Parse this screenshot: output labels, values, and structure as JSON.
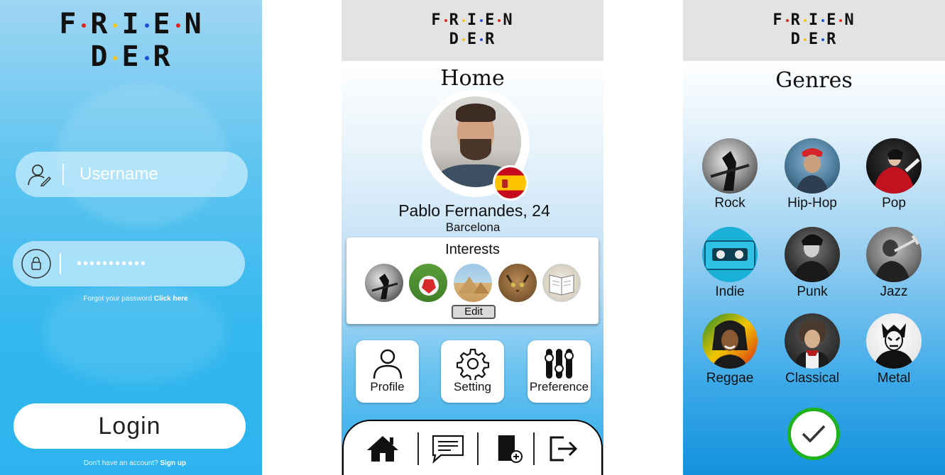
{
  "app": {
    "logo_line1": [
      "F",
      "R",
      "I",
      "E",
      "N"
    ],
    "logo_line2": [
      "D",
      "E",
      "R"
    ]
  },
  "login": {
    "username_placeholder": "Username",
    "password_value": "•••••••••••",
    "forgot_text": "Forgot your password",
    "forgot_link": "Click here",
    "login_label": "Login",
    "signup_text": "Don't have an account?",
    "signup_link": "Sign up"
  },
  "home": {
    "title": "Home",
    "user_name": "Pablo Fernandes, 24",
    "user_city": "Barcelona",
    "interests_title": "Interests",
    "interests": [
      "rock-guitar-photo",
      "football-photo",
      "pyramids-photo",
      "cat-photo",
      "book-photo"
    ],
    "edit_label": "Edit",
    "tiles": {
      "profile": "Profile",
      "setting": "Setting",
      "preference": "Preference"
    },
    "nav": [
      "home-icon",
      "chat-icon",
      "add-page-icon",
      "logout-icon"
    ]
  },
  "genres": {
    "title": "Genres",
    "items": [
      "Rock",
      "Hip-Hop",
      "Pop",
      "Indie",
      "Punk",
      "Jazz",
      "Reggae",
      "Classical",
      "Metal"
    ],
    "confirm_icon": "check-icon"
  },
  "colors": {
    "login_bg": "#33b7ee",
    "header_bg": "#e3e3e3",
    "confirm_ring": "#1fb21f",
    "dot_red": "#e0261b",
    "dot_blue": "#1f4fd6",
    "dot_yellow": "#f5c518"
  }
}
